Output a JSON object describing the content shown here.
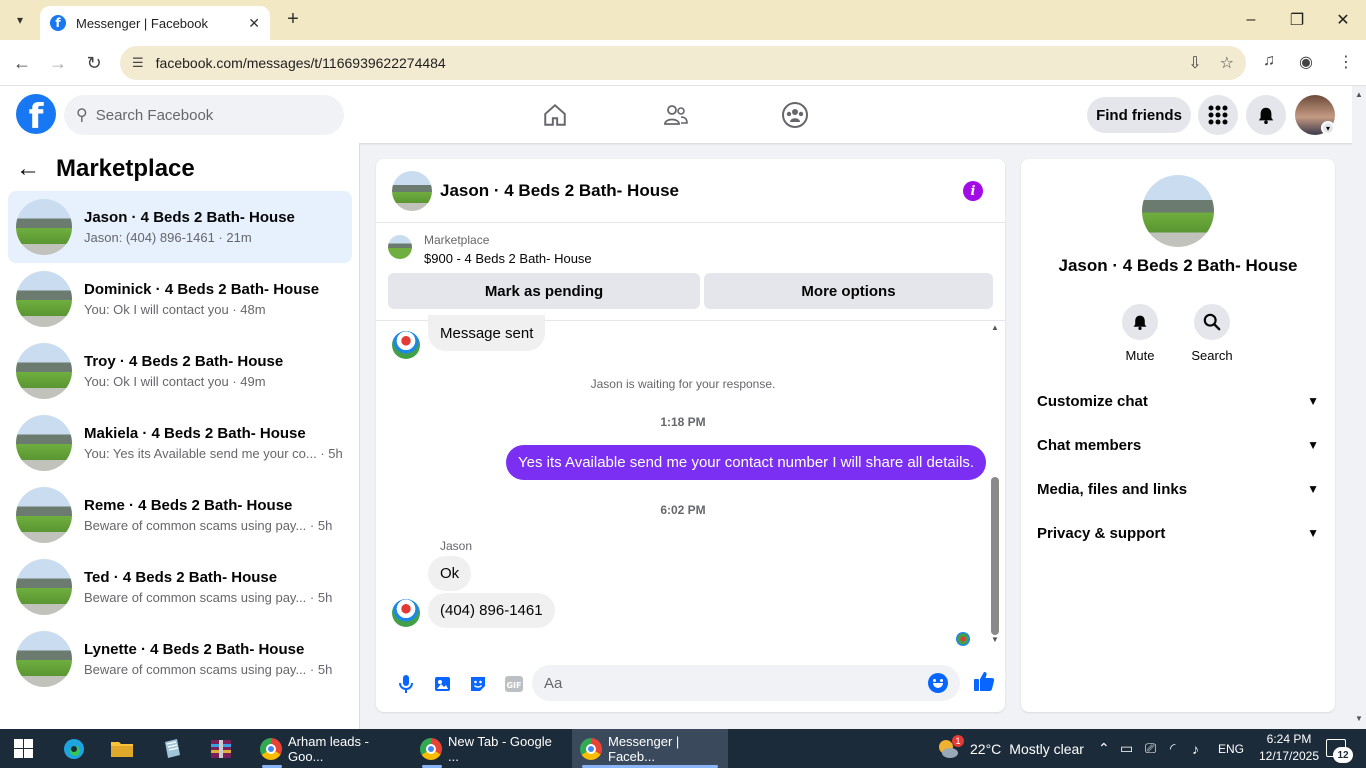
{
  "browser": {
    "tab_title": "Messenger | Facebook",
    "url": "facebook.com/messages/t/1166939622274484"
  },
  "fb_header": {
    "search_placeholder": "Search Facebook",
    "find_friends_label": "Find friends",
    "brand_color": "#1877f2"
  },
  "sidebar": {
    "title": "Marketplace",
    "conversations": [
      {
        "name": "Jason · 4 Beds 2 Bath- House",
        "preview": "Jason: (404) 896-1461 · 21m",
        "active": true
      },
      {
        "name": "Dominick · 4 Beds 2 Bath- House",
        "preview": "You: Ok I will contact you · 48m"
      },
      {
        "name": "Troy · 4 Beds 2 Bath- House",
        "preview": "You: Ok I will contact you · 49m"
      },
      {
        "name": "Makiela · 4 Beds 2 Bath- House",
        "preview": "You: Yes its Available send me your co... · 5h"
      },
      {
        "name": "Reme · 4 Beds 2 Bath- House",
        "preview": "Beware of common scams using pay... · 5h"
      },
      {
        "name": "Ted · 4 Beds 2 Bath- House",
        "preview": "Beware of common scams using pay... · 5h"
      },
      {
        "name": "Lynette · 4 Beds 2 Bath- House",
        "preview": "Beware of common scams using pay... · 5h"
      }
    ]
  },
  "chat": {
    "header_name": "Jason · 4 Beds 2 Bath- House",
    "marketplace_label": "Marketplace",
    "listing": "$900 - 4 Beds 2 Bath- House",
    "mark_pending_label": "Mark as pending",
    "more_options_label": "More options",
    "messages": {
      "sent_top": "Message sent",
      "waiting": "Jason is waiting for your response.",
      "time1": "1:18 PM",
      "out1": "Yes its Available send me your contact number I will share all details.",
      "time2": "6:02 PM",
      "sender": "Jason",
      "in1": "Ok",
      "in2": "(404) 896-1461"
    },
    "composer_placeholder": "Aa",
    "accent_color": "#7a2ff2"
  },
  "info_panel": {
    "name": "Jason · 4 Beds 2 Bath- House",
    "mute_label": "Mute",
    "search_label": "Search",
    "sections": [
      "Customize chat",
      "Chat members",
      "Media, files and links",
      "Privacy & support"
    ]
  },
  "taskbar": {
    "tasks": [
      "Arham leads - Goo...",
      "New Tab - Google ...",
      "Messenger | Faceb..."
    ],
    "weather_temp": "22°C",
    "weather_desc": "Mostly clear",
    "weather_badge": "1",
    "language": "ENG",
    "time": "6:24 PM",
    "date": "12/17/2025",
    "notifications": "12"
  }
}
